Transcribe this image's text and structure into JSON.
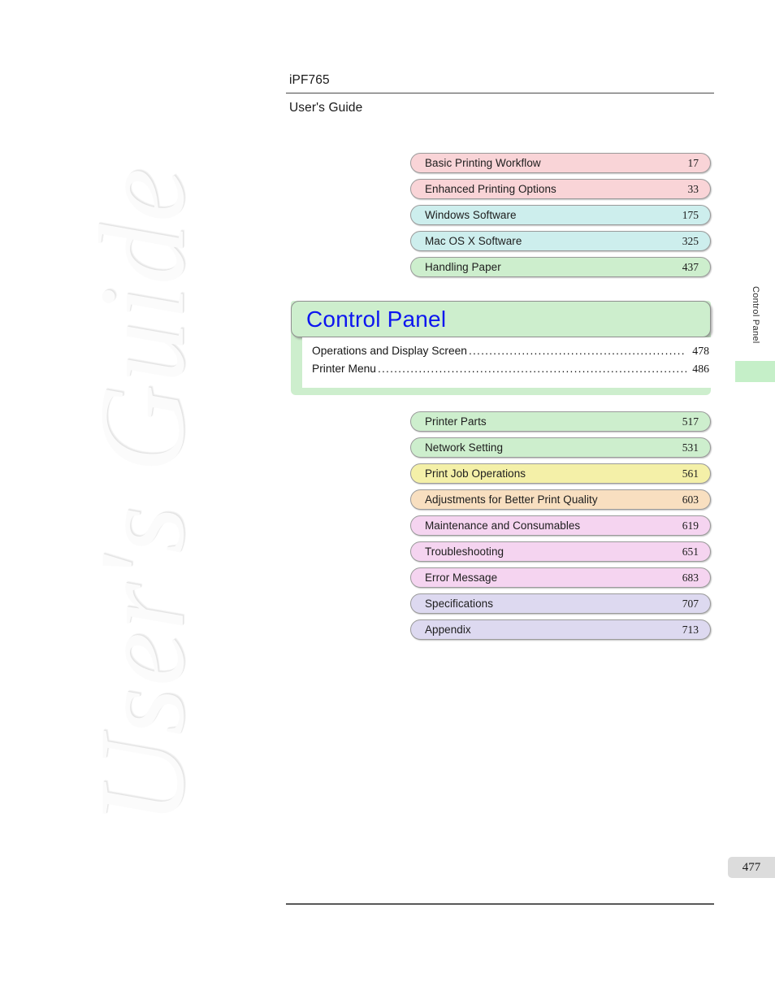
{
  "watermark": {
    "text": "User's Guide"
  },
  "header": {
    "model": "iPF765",
    "guide": "User's Guide"
  },
  "chapters_top": [
    {
      "title": "Basic Printing Workflow",
      "page": "17",
      "color": "#f9d4d7"
    },
    {
      "title": "Enhanced Printing Options",
      "page": "33",
      "color": "#f9d4d7"
    },
    {
      "title": "Windows Software",
      "page": "175",
      "color": "#cdeeed"
    },
    {
      "title": "Mac OS X Software",
      "page": "325",
      "color": "#cdeeed"
    },
    {
      "title": "Handling Paper",
      "page": "437",
      "color": "#cdeecd"
    }
  ],
  "current_chapter": {
    "title": "Control Panel",
    "title_color": "#0d16f0",
    "panel_color": "#cdeecd",
    "entries": [
      {
        "label": "Operations and Display Screen",
        "page": "478"
      },
      {
        "label": "Printer Menu",
        "page": "486"
      }
    ]
  },
  "chapters_bottom": [
    {
      "title": "Printer Parts",
      "page": "517",
      "color": "#cdeecd"
    },
    {
      "title": "Network Setting",
      "page": "531",
      "color": "#cdeecd"
    },
    {
      "title": "Print Job Operations",
      "page": "561",
      "color": "#f4f0a8"
    },
    {
      "title": "Adjustments for Better Print Quality",
      "page": "603",
      "color": "#f8dfc0"
    },
    {
      "title": "Maintenance and Consumables",
      "page": "619",
      "color": "#f5d4f0"
    },
    {
      "title": "Troubleshooting",
      "page": "651",
      "color": "#f5d4f0"
    },
    {
      "title": "Error Message",
      "page": "683",
      "color": "#f5d4f0"
    },
    {
      "title": "Specifications",
      "page": "707",
      "color": "#ddd9f0"
    },
    {
      "title": "Appendix",
      "page": "713",
      "color": "#ddd9f0"
    }
  ],
  "side_tab": {
    "label": "Control Panel",
    "color": "#c5efc8"
  },
  "footer": {
    "page_number": "477"
  }
}
